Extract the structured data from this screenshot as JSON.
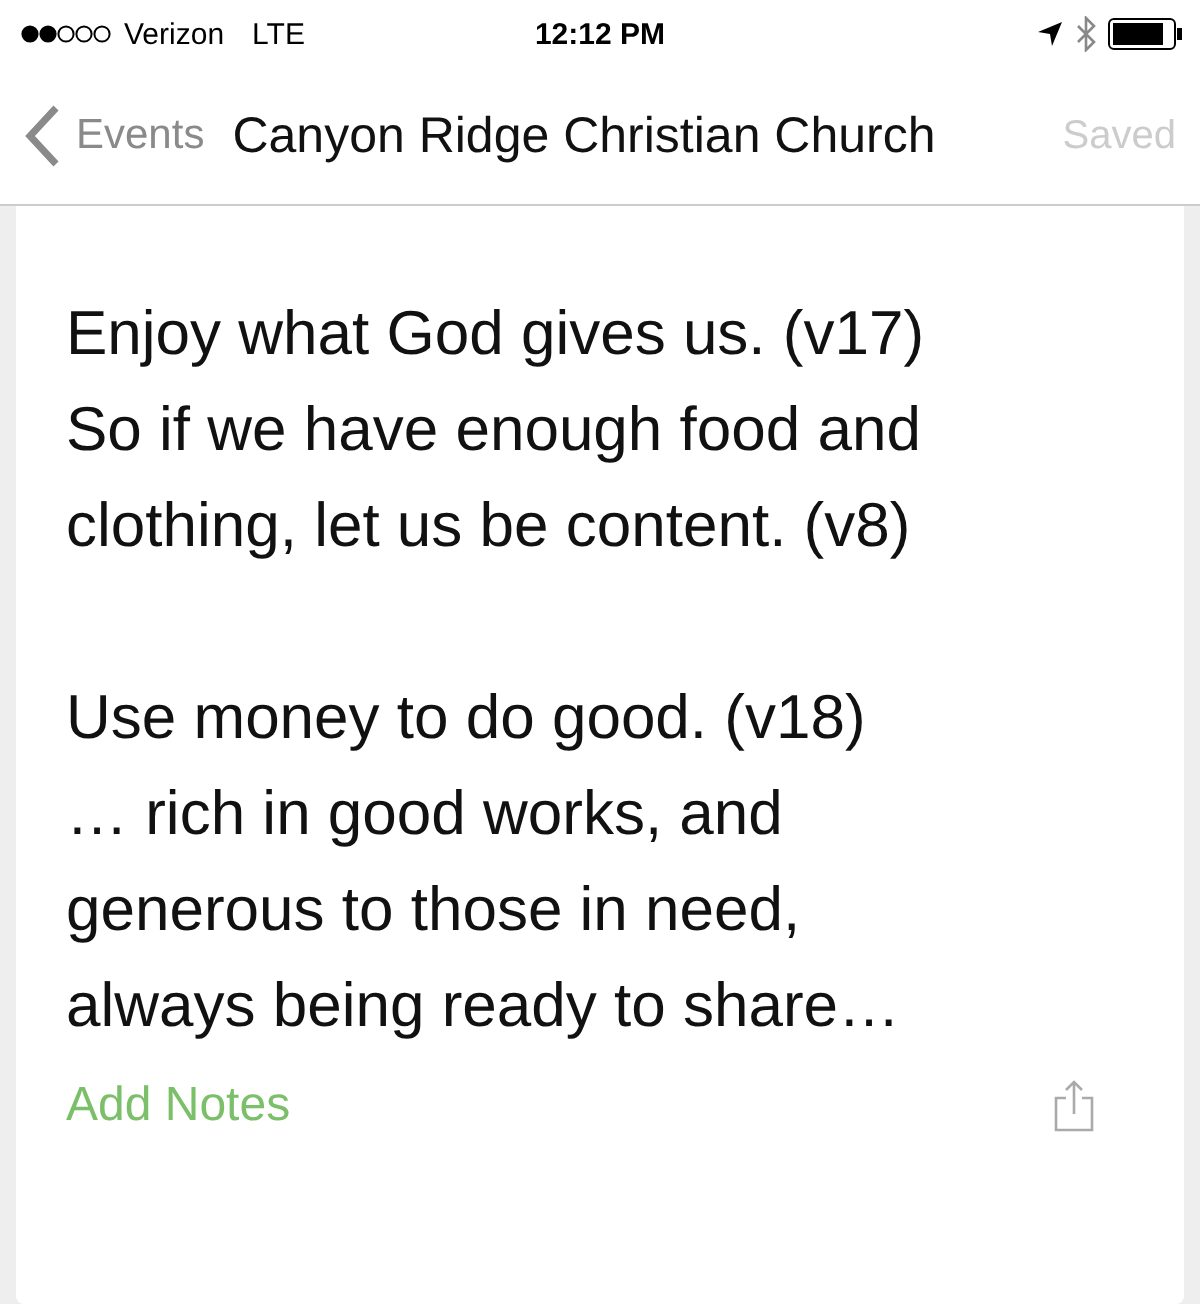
{
  "status_bar": {
    "carrier": "Verizon",
    "network": "LTE",
    "time": "12:12 PM"
  },
  "nav_bar": {
    "back": "Events",
    "title": "Canyon Ridge Christian Church",
    "action": "Saved"
  },
  "notes": {
    "paragraphs": [
      [
        "Enjoy what God gives us. (v17)",
        "So if we have enough food and",
        "clothing, let us be content. (v8)"
      ],
      [
        "Use money to do good. (v18)",
        "… rich in good works, and",
        "generous to those in need,",
        "always being ready to share…"
      ]
    ]
  },
  "footer": {
    "add_notes": "Add Notes"
  }
}
